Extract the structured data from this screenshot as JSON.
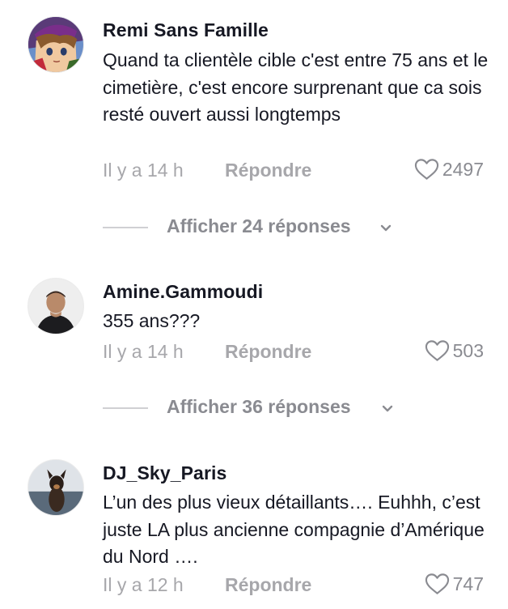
{
  "comments": [
    {
      "username": "Remi Sans Famille",
      "text": "Quand ta clientèle cible c'est entre 75 ans et le cimetière, c'est encore surprenant que ca sois resté ouvert aussi longtemps",
      "time": "Il y a 14 h",
      "reply_label": "Répondre",
      "likes": "2497",
      "avatar_icon": "anime-character-avatar",
      "view_replies": "Afficher 24 réponses"
    },
    {
      "username": "Amine.Gammoudi",
      "text": "355 ans???",
      "time": "Il y a 14 h",
      "reply_label": "Répondre",
      "likes": "503",
      "avatar_icon": "person-photo-avatar",
      "view_replies": "Afficher 36 réponses"
    },
    {
      "username": "DJ_Sky_Paris",
      "text": "L’un des plus vieux détaillants…. Euhhh, c’est juste LA plus ancienne compagnie d’Amérique du Nord ….",
      "time": "Il y a 12 h",
      "reply_label": "Répondre",
      "likes": "747",
      "avatar_icon": "dog-photo-avatar"
    }
  ],
  "colors": {
    "text": "#161823",
    "muted": "#a7a7ab",
    "secondary": "#8a8b91",
    "divider": "#d0d0d3"
  }
}
